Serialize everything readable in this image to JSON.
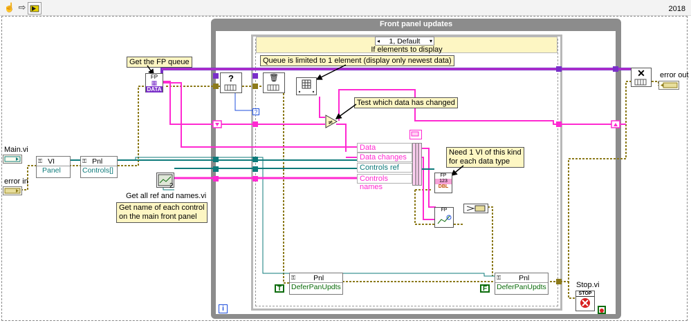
{
  "toolbar": {
    "run_icon": "hand-icon",
    "step_icon": "arrow-icon",
    "highlight_icon": "highlight-icon",
    "version": "2018"
  },
  "loop": {
    "title": "Front panel updates",
    "info_glyph": "i"
  },
  "case_structure": {
    "selector_value": "1, Default",
    "label": "If elements to display"
  },
  "comments": {
    "fp_queue": "Get the FP queue",
    "queue_limit": "Queue is limited to 1 element (display only newest data)",
    "test_change": "Test which data has changed",
    "one_vi": [
      "Need 1 VI of this kind",
      "for each data type"
    ],
    "get_names": [
      "Get name of each control",
      "on the main front panel"
    ]
  },
  "labels": {
    "main_vi": "Main.vi",
    "error_in": "error in",
    "error_out": "error out",
    "get_refs": "Get all ref and names.vi",
    "stop_vi": "Stop.vi"
  },
  "nodes": {
    "vi_prop": {
      "class": "VI",
      "property": "Panel"
    },
    "pnl_prop": {
      "class": "Pnl",
      "property": "Controls[]"
    },
    "fp_data": {
      "top": "FP",
      "bottom": "DATA"
    },
    "defer_left": {
      "class": "Pnl",
      "property": "DeferPanUpdts",
      "const": "T"
    },
    "defer_right": {
      "class": "Pnl",
      "property": "DeferPanUpdts",
      "const": "F"
    },
    "stop": {
      "text": "STOP"
    },
    "dbl_vi": {
      "top": "FP",
      "num": "123",
      "type": "DBL"
    },
    "graph_vi": {
      "top": "FP"
    },
    "subvi_index": "2"
  },
  "unbundle": [
    "Data",
    "Data changes",
    "Controls ref",
    "Controls names"
  ],
  "colors": {
    "pink": "#ff29d1",
    "purple": "#7a2fc9",
    "teal": "#0d7a7a",
    "olive": "#8c7a1a",
    "blue": "#1f4fdc",
    "green": "#0a6b0a"
  }
}
